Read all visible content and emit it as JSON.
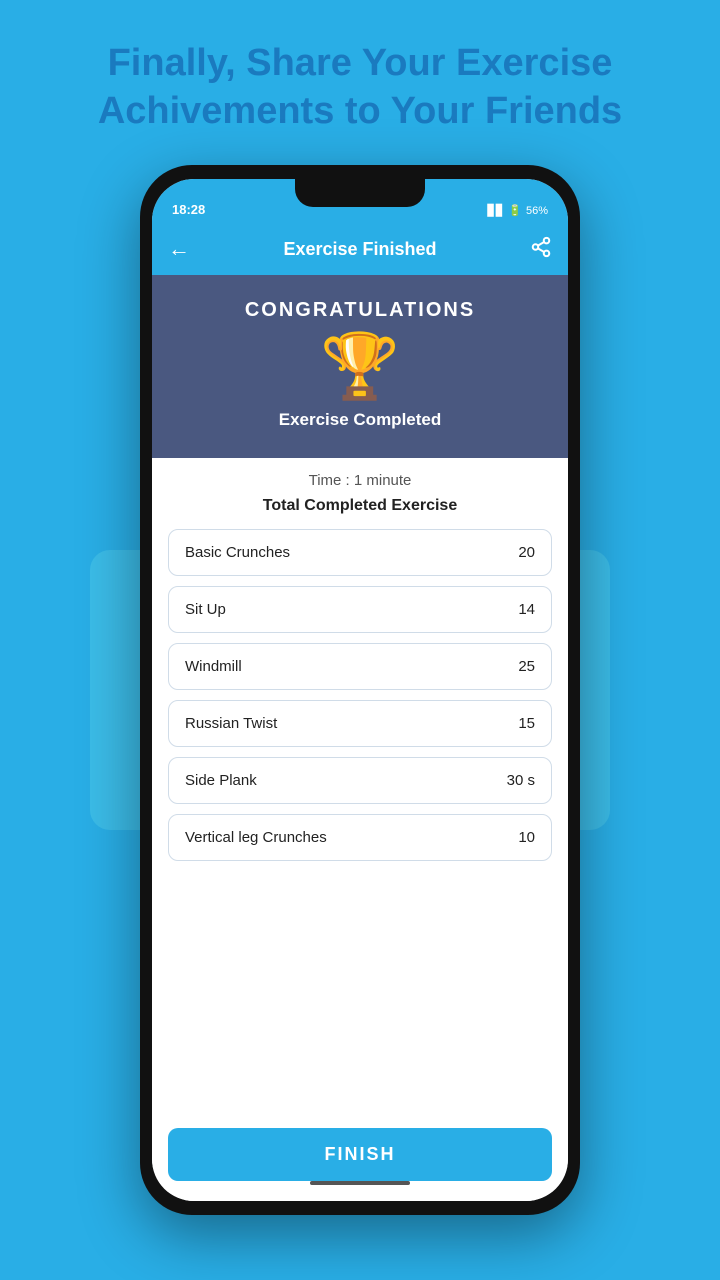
{
  "page": {
    "title_line1": "Finally, Share Your Exercise",
    "title_line2": "Achivements to Your Friends"
  },
  "status_bar": {
    "time": "18:28",
    "battery": "56%"
  },
  "app_bar": {
    "title": "Exercise Finished",
    "back_icon": "←",
    "share_icon": "⤢"
  },
  "congrats": {
    "label": "CONGRATULATIONS",
    "trophy": "🏆",
    "completed_label": "Exercise Completed"
  },
  "summary": {
    "time_label": "Time : 1 minute",
    "total_label": "Total Completed Exercise"
  },
  "exercises": [
    {
      "name": "Basic Crunches",
      "count": "20"
    },
    {
      "name": "Sit Up",
      "count": "14"
    },
    {
      "name": "Windmill",
      "count": "25"
    },
    {
      "name": "Russian Twist",
      "count": "15"
    },
    {
      "name": "Side Plank",
      "count": "30 s"
    },
    {
      "name": "Vertical leg Crunches",
      "count": "10"
    }
  ],
  "finish_button": {
    "label": "FINISH"
  }
}
